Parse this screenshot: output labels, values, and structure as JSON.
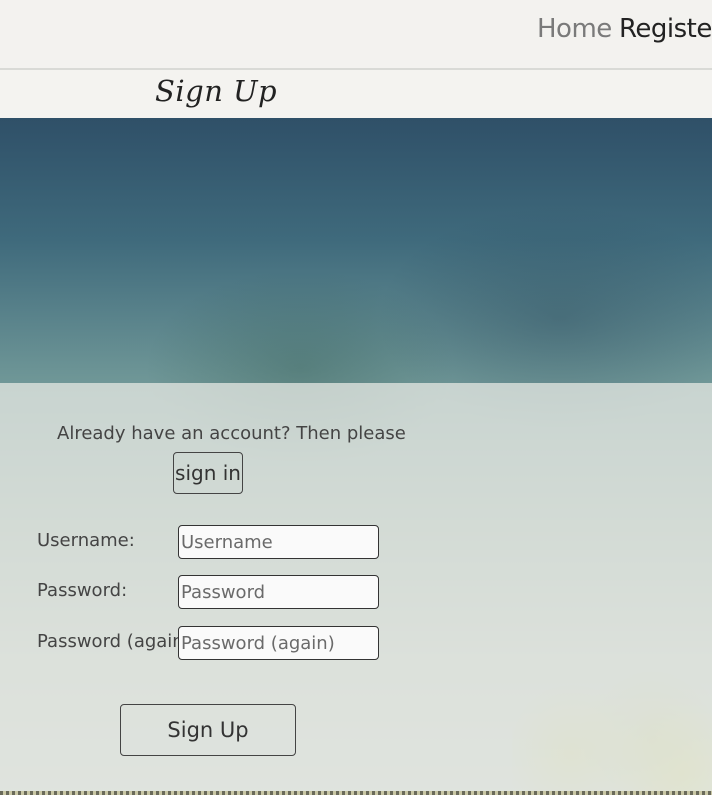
{
  "nav": {
    "home_label": "Home",
    "register_label": "Register"
  },
  "page": {
    "title": "Sign Up"
  },
  "form": {
    "prompt_text": "Already have an account? Then please",
    "signin_label": "sign in",
    "username_label": "Username:",
    "username_placeholder": "Username",
    "password_label": "Password:",
    "password_placeholder": "Password",
    "password2_label": "Password (again):",
    "password2_placeholder": "Password (again)",
    "submit_label": "Sign Up"
  }
}
